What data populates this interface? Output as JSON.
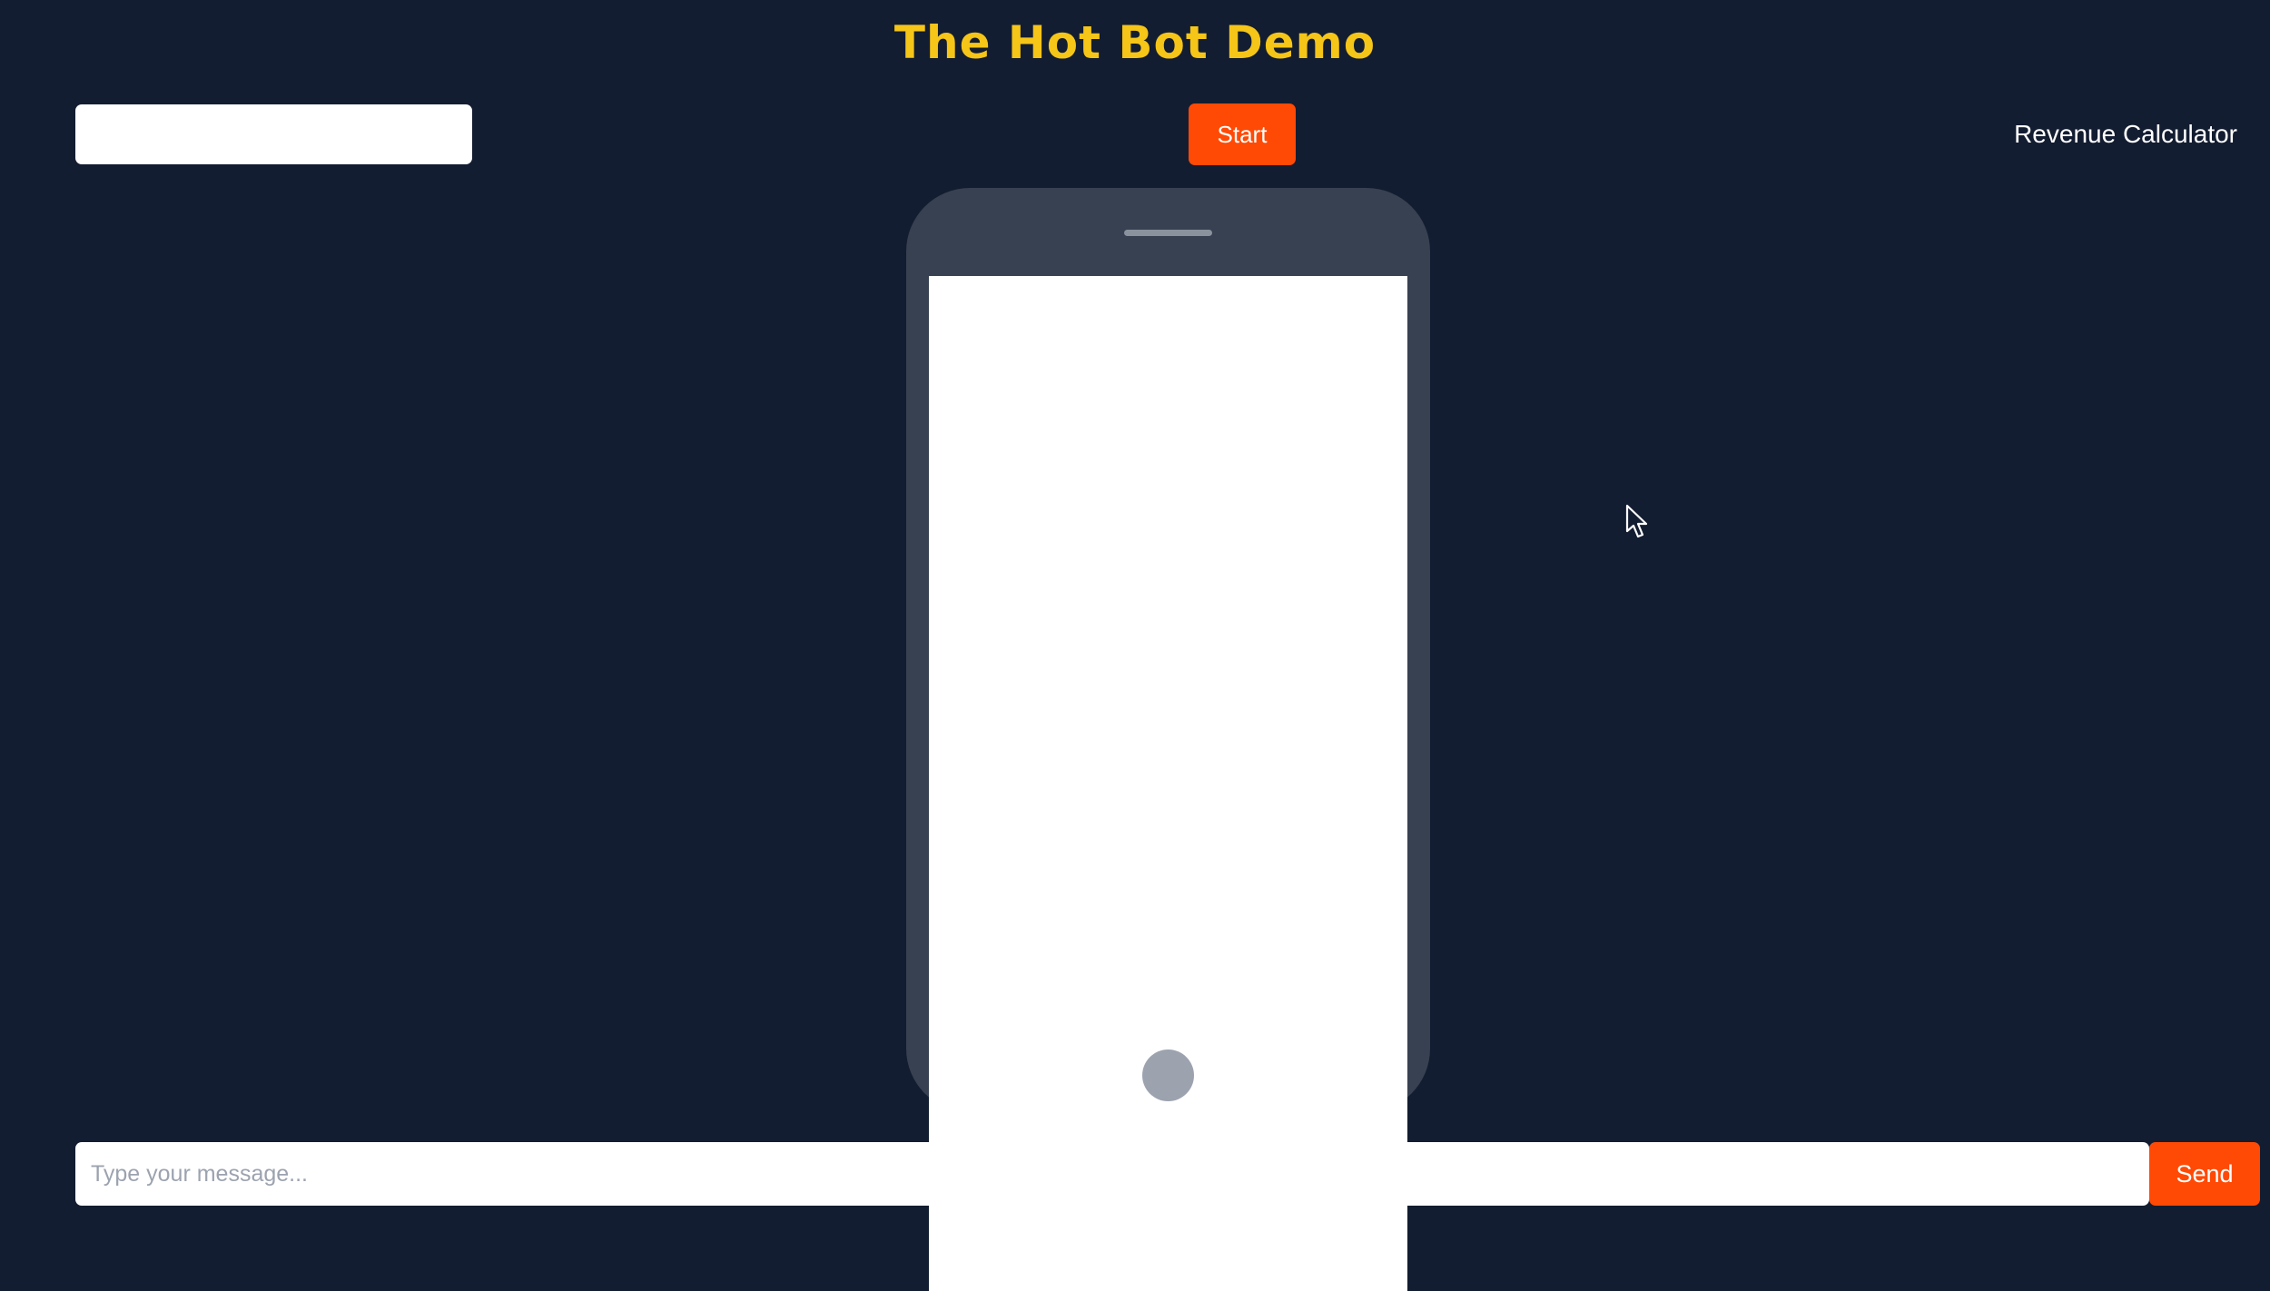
{
  "header": {
    "title": "The Hot Bot Demo",
    "title_color": "#f5c518"
  },
  "toolbar": {
    "name_input_value": "",
    "name_input_placeholder": "",
    "start_label": "Start",
    "revenue_link_label": "Revenue Calculator"
  },
  "chat": {
    "message_placeholder": "Type your message...",
    "message_value": "",
    "send_label": "Send"
  },
  "colors": {
    "background": "#131d31",
    "accent": "#ff4a05",
    "phone_frame": "#374151",
    "phone_screen": "#ffffff"
  },
  "icons": {
    "pointer": "mouse-pointer-icon",
    "phone_home": "phone-home-button-icon",
    "phone_speaker": "phone-speaker-icon"
  }
}
